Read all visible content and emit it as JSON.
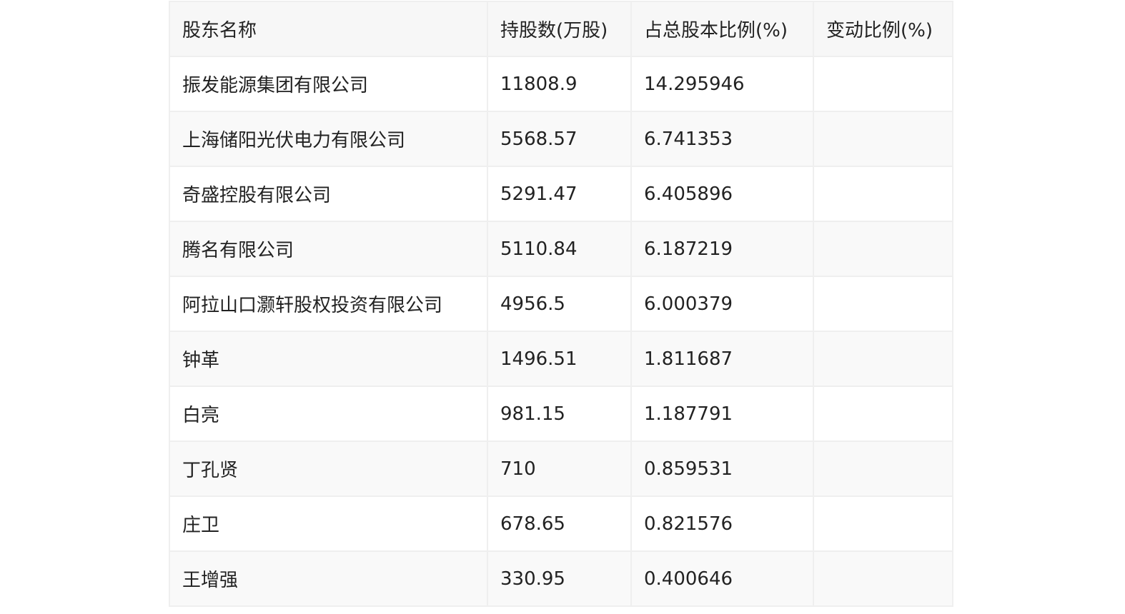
{
  "table": {
    "headers": {
      "name": "股东名称",
      "shares": "持股数(万股)",
      "ratio": "占总股本比例(%)",
      "change": "变动比例(%)"
    },
    "rows": [
      {
        "name": "振发能源集团有限公司",
        "shares": "11808.9",
        "ratio": "14.295946",
        "change": ""
      },
      {
        "name": "上海储阳光伏电力有限公司",
        "shares": "5568.57",
        "ratio": "6.741353",
        "change": ""
      },
      {
        "name": "奇盛控股有限公司",
        "shares": "5291.47",
        "ratio": "6.405896",
        "change": ""
      },
      {
        "name": "腾名有限公司",
        "shares": "5110.84",
        "ratio": "6.187219",
        "change": ""
      },
      {
        "name": "阿拉山口灏轩股权投资有限公司",
        "shares": "4956.5",
        "ratio": "6.000379",
        "change": ""
      },
      {
        "name": "钟革",
        "shares": "1496.51",
        "ratio": "1.811687",
        "change": ""
      },
      {
        "name": "白亮",
        "shares": "981.15",
        "ratio": "1.187791",
        "change": ""
      },
      {
        "name": "丁孔贤",
        "shares": "710",
        "ratio": "0.859531",
        "change": ""
      },
      {
        "name": "庄卫",
        "shares": "678.65",
        "ratio": "0.821576",
        "change": ""
      },
      {
        "name": "王增强",
        "shares": "330.95",
        "ratio": "0.400646",
        "change": ""
      }
    ]
  }
}
